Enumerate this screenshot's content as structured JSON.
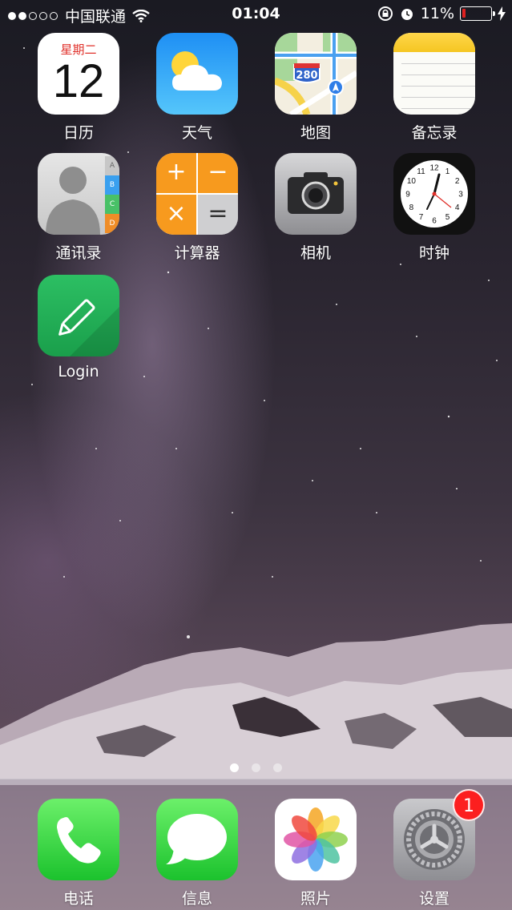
{
  "status_bar": {
    "carrier": "中国联通",
    "time": "01:04",
    "battery_percent_text": "11%",
    "battery_level": 0.11,
    "signal_bars_filled": 2,
    "signal_bars_total": 5
  },
  "apps": {
    "calendar": {
      "label": "日历",
      "weekday": "星期二",
      "day": "12"
    },
    "weather": {
      "label": "天气"
    },
    "maps": {
      "label": "地图",
      "shield": "280"
    },
    "notes": {
      "label": "备忘录"
    },
    "contacts": {
      "label": "通讯录",
      "tabs": [
        "A",
        "B",
        "C",
        "D"
      ]
    },
    "calculator": {
      "label": "计算器"
    },
    "camera": {
      "label": "相机"
    },
    "clock": {
      "label": "时钟",
      "numerals": [
        "12",
        "1",
        "2",
        "3",
        "4",
        "5",
        "6",
        "7",
        "8",
        "9",
        "10",
        "11"
      ]
    },
    "login": {
      "label": "Login"
    }
  },
  "page_indicator": {
    "pages": 3,
    "current": 1
  },
  "dock": {
    "phone": {
      "label": "电话"
    },
    "messages": {
      "label": "信息"
    },
    "photos": {
      "label": "照片"
    },
    "settings": {
      "label": "设置",
      "badge": "1"
    }
  },
  "colors": {
    "badge_red": "#fc1f1f",
    "battery_low": "#e02020",
    "calendar_weekday": "#e0302a"
  }
}
